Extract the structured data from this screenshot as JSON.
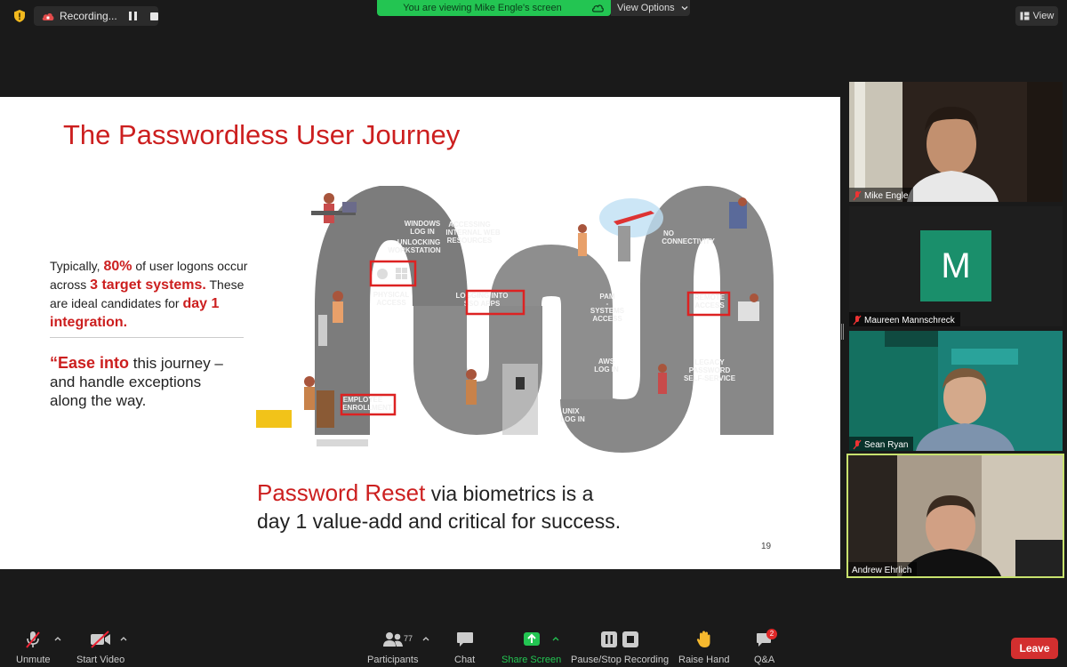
{
  "topbar": {
    "recording_label": "Recording...",
    "viewing_banner": "You are viewing Mike Engle's screen",
    "view_options": "View Options",
    "view_button": "View"
  },
  "slide": {
    "title": "The Passwordless User Journey",
    "stat_prefix": "Typically, ",
    "stat_pct": "80%",
    "stat_mid": " of user logons occur across ",
    "stat_systems": "3 target systems.",
    "stat_candidates": " These are ideal candidates for ",
    "stat_day1": "day 1 integration.",
    "ease_quote": "“Ease into",
    "ease_rest": " this journey – and handle exceptions along the way.",
    "bottom_red": "Password Reset",
    "bottom_line1_rest": " via biometrics is a",
    "bottom_line2": "day 1 value-add and critical for success.",
    "page_number": "19",
    "journey_labels": {
      "windows": [
        "WINDOWS",
        "LOG IN",
        "UNLOCKING",
        "WORKSTATION"
      ],
      "accessing": [
        "ACCESSING",
        "INTERNAL WEB",
        "RESOURCES"
      ],
      "physical": [
        "PHYSICAL",
        "ACCESS"
      ],
      "sso": [
        "LOGGING INTO",
        "SSO APPS"
      ],
      "employee": [
        "EMPLOYEE",
        "ENROLLMENT"
      ],
      "pam": [
        "PAM",
        "-",
        "SYSTEMS",
        "ACCESS"
      ],
      "aws": [
        "AWS",
        "LOG IN"
      ],
      "unix": [
        "UNIX",
        "LOG IN"
      ],
      "noconn": [
        "NO",
        "CONNECTIVITY"
      ],
      "remote": [
        "REMOTE",
        "ACCESS"
      ],
      "legacy": [
        "LEGACY",
        "PASSWORD",
        "SELF-SERVICE"
      ]
    }
  },
  "participants": [
    {
      "name": "Mike Engle",
      "muted": true
    },
    {
      "name": "Maureen Mannschreck",
      "initial": "M",
      "muted": true,
      "avatar_color": "#1a8f6b"
    },
    {
      "name": "Sean Ryan",
      "muted": true
    },
    {
      "name": "Andrew Ehrlich",
      "muted": false,
      "active": true
    }
  ],
  "toolbar": {
    "unmute": "Unmute",
    "start_video": "Start Video",
    "participants": "Participants",
    "participant_count": "77",
    "chat": "Chat",
    "share_screen": "Share Screen",
    "pause_recording": "Pause/Stop Recording",
    "raise_hand": "Raise Hand",
    "qa": "Q&A",
    "qa_badge": "2",
    "leave": "Leave"
  },
  "colors": {
    "accent_red": "#cc1f1f",
    "share_green": "#23c552",
    "leave_red": "#d32f2f",
    "active_border": "#c8e26e"
  }
}
